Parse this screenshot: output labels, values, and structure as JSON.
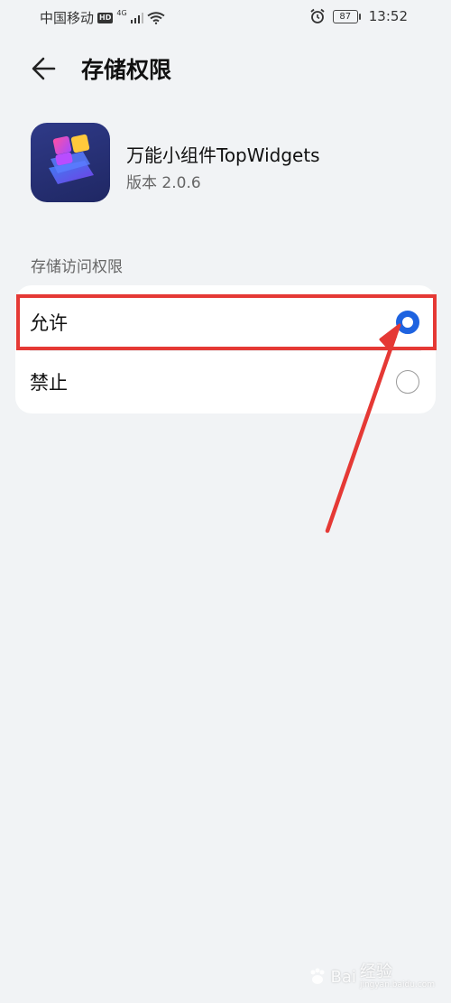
{
  "status_bar": {
    "carrier": "中国移动",
    "hd_badge": "HD",
    "network": "4G",
    "battery": "87",
    "time": "13:52"
  },
  "header": {
    "title": "存储权限",
    "back_icon": "arrow-left-icon"
  },
  "app": {
    "name": "万能小组件TopWidgets",
    "version": "版本 2.0.6",
    "icon": "app-icon"
  },
  "permission": {
    "section_label": "存储访问权限",
    "options": [
      {
        "label": "允许",
        "checked": true
      },
      {
        "label": "禁止",
        "checked": false
      }
    ]
  },
  "annotation": {
    "highlight_color": "#e53935"
  },
  "watermark": {
    "brand": "Bai",
    "suffix": "经验",
    "url": "jingyan.baidu.com"
  },
  "colors": {
    "accent": "#1e63e0",
    "background": "#f1f3f5",
    "card": "#ffffff"
  }
}
